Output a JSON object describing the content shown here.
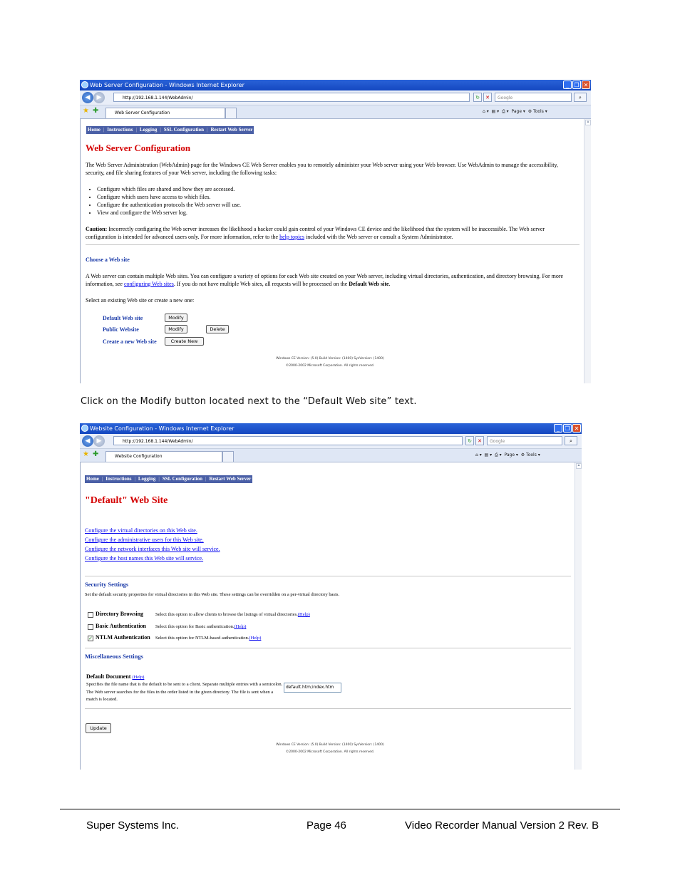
{
  "window1": {
    "title": "Web Server Configuration - Windows Internet Explorer",
    "address": "http://192.168.1.144/WebAdmin/",
    "search_placeholder": "Google",
    "tab_title": "Web Server Configuration",
    "tools": [
      "Page",
      "Tools"
    ],
    "nav": [
      "Home",
      "Instructions",
      "Logging",
      "SSL Configuration",
      "Restart Web Server"
    ],
    "heading": "Web Server Configuration",
    "intro": "The Web Server Administration (WebAdmin) page for the Windows CE Web Server enables you to remotely administer your Web server using your Web browser. Use WebAdmin to manage the accessibility, security, and file sharing features of your Web server, including the following tasks:",
    "tasks": [
      "Configure which files are shared and how they are accessed.",
      "Configure which users have access to which files.",
      "Configure the authentication protocols the Web server will use.",
      "View and configure the Web server log."
    ],
    "caution_label": "Caution:",
    "caution_text_1": "Incorrectly configuring the Web server increases the likelihood a hacker could gain control of your Windows CE device and the likelihood that the system will be inaccessible. The Web server configuration is intended for advanced users only. For more information, refer to the",
    "caution_link": "help topics",
    "caution_text_2": "included with the Web server or consult a System Administrator.",
    "choose_heading": "Choose a Web site",
    "sites_text_1": "A Web server can contain multiple Web sites. You can configure a variety of options for each Web site created on your Web server, including virtual directories, authentication, and directory browsing. For more information, see",
    "sites_link": "configuring Web sites",
    "sites_text_2": ". If you do not have multiple Web sites, all requests will be processed on the",
    "sites_bold": "Default Web site",
    "select_text": "Select an existing Web site or create a new one:",
    "site_default": "Default Web site",
    "site_public": "Public Website",
    "site_new": "Create a new Web site",
    "modify_label": "Modify",
    "delete_label": "Delete",
    "createnew_label": "Create New",
    "version_line": "Windows CE Version: (5.0) Build Version: (1400) SysVersion: (1400)",
    "copyright_line": "©2000-2002 Microsoft Corporation. All rights reserved."
  },
  "caption": {
    "before": "Click on the ",
    "bold": "Modify",
    "after": " button located next to the “Default Web site” text."
  },
  "window2": {
    "title": "Website Configuration - Windows Internet Explorer",
    "address": "http://192.168.1.144/WebAdmin/",
    "search_placeholder": "Google",
    "tab_title": "Website Configuration",
    "tools": [
      "Page",
      "Tools"
    ],
    "nav": [
      "Home",
      "Instructions",
      "Logging",
      "SSL Configuration",
      "Restart Web Server"
    ],
    "heading": "\"Default\" Web Site",
    "links": [
      "Configure the virtual directories on this Web site.",
      "Configure the administrative users for this Web site.",
      "Configure the network interfaces this Web site will service.",
      "Configure the host names this Web site will service."
    ],
    "security_heading": "Security Settings",
    "security_desc": "Set the default security properties for virtual directories in this Web site. These settings can be overridden on a per-virtual directory basis.",
    "options": [
      {
        "label": "Directory Browsing",
        "desc": "Select this option to allow clients to browse the listings of virtual directories.",
        "help": "(Help)",
        "checked": false
      },
      {
        "label": "Basic Authentication",
        "desc": "Select this option for Basic authentication.",
        "help": "(Help)",
        "checked": false
      },
      {
        "label": "NTLM Authentication",
        "desc": "Select this option for NTLM-based authentication.",
        "help": "(Help)",
        "checked": true
      }
    ],
    "misc_heading": "Miscellaneous Settings",
    "default_doc_label": "Default Document",
    "default_doc_help": "(Help)",
    "default_doc_desc": "Specifies the file name that is the default to be sent to a client. Separate multiple entries with a semicolon. The Web server searches for the files in the order listed in the given directory. The file is sent when a match is located.",
    "default_doc_value": "default.htm;index.htm",
    "update_label": "Update",
    "version_line": "Windows CE Version: (5.0) Build Version: (1400) SysVersion: (1400)",
    "copyright_line": "©2000-2002 Microsoft Corporation. All rights reserved."
  },
  "footer": {
    "company": "Super Systems Inc.",
    "page": "Page 46",
    "manual": "Video Recorder Manual Version 2 Rev. B"
  }
}
